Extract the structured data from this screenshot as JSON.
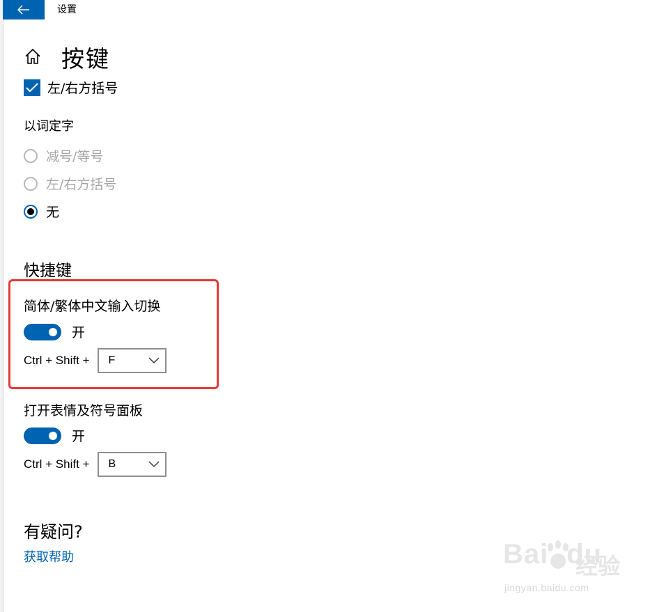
{
  "window": {
    "title": "设置"
  },
  "page": {
    "title": "按键"
  },
  "brackets_option": {
    "label": "左/右方括号",
    "checked": true
  },
  "word_select": {
    "label": "以词定字",
    "options": [
      {
        "label": "减号/等号",
        "disabled": true,
        "selected": false
      },
      {
        "label": "左/右方括号",
        "disabled": true,
        "selected": false
      },
      {
        "label": "无",
        "disabled": false,
        "selected": true
      }
    ]
  },
  "shortcuts": {
    "heading": "快捷键",
    "items": [
      {
        "title": "简体/繁体中文输入切换",
        "toggle_label": "开",
        "toggle_on": true,
        "hotkey_prefix": "Ctrl + Shift +",
        "key": "F"
      },
      {
        "title": "打开表情及符号面板",
        "toggle_label": "开",
        "toggle_on": true,
        "hotkey_prefix": "Ctrl + Shift +",
        "key": "B"
      }
    ]
  },
  "help": {
    "heading": "有疑问?",
    "link": "获取帮助"
  },
  "watermark": {
    "brand": "Bai",
    "brand_suffix": "du",
    "cn": "经验",
    "url": "jingyan.baidu.com"
  },
  "colors": {
    "accent": "#0063b1",
    "highlight": "#e53935"
  }
}
